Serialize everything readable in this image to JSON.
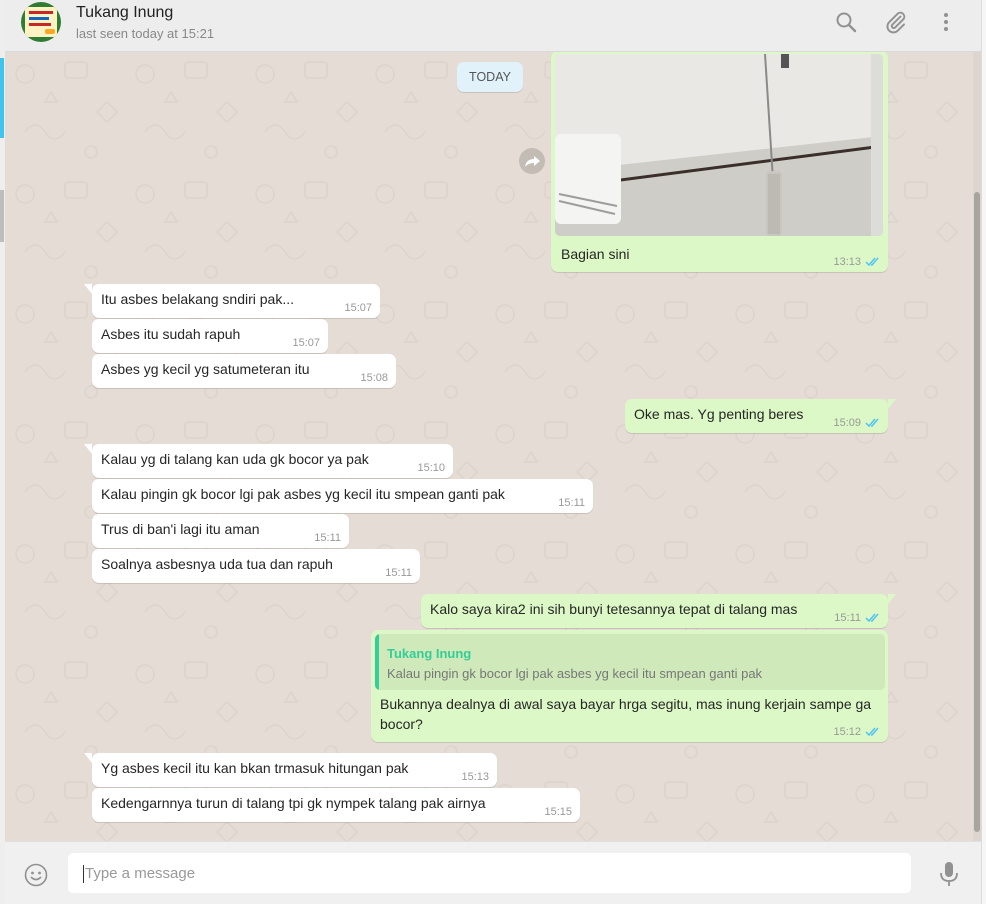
{
  "header": {
    "contact_name": "Tukang Inung",
    "status": "last seen today at 15:21",
    "icons": [
      "search-icon",
      "attach-icon",
      "menu-icon"
    ]
  },
  "date_divider": "TODAY",
  "messages": [
    {
      "id": "m1",
      "dir": "out",
      "type": "image",
      "caption": "Bagian sini",
      "time": "13:13",
      "status": "read"
    },
    {
      "id": "m2",
      "dir": "in",
      "text": "Itu asbes belakang sndiri pak...",
      "time": "15:07"
    },
    {
      "id": "m3",
      "dir": "in",
      "text": "Asbes itu sudah rapuh",
      "time": "15:07"
    },
    {
      "id": "m4",
      "dir": "in",
      "text": "Asbes yg kecil yg satumeteran itu",
      "time": "15:08"
    },
    {
      "id": "m5",
      "dir": "out",
      "text": "Oke mas. Yg penting beres",
      "time": "15:09",
      "status": "read"
    },
    {
      "id": "m6",
      "dir": "in",
      "text": "Kalau yg di talang kan uda gk bocor ya pak",
      "time": "15:10"
    },
    {
      "id": "m7",
      "dir": "in",
      "text": "Kalau pingin gk bocor lgi pak asbes yg kecil itu smpean ganti pak",
      "time": "15:11"
    },
    {
      "id": "m8",
      "dir": "in",
      "text": "Trus di ban'i lagi itu aman",
      "time": "15:11"
    },
    {
      "id": "m9",
      "dir": "in",
      "text": "Soalnya asbesnya uda tua dan rapuh",
      "time": "15:11"
    },
    {
      "id": "m10",
      "dir": "out",
      "text": "Kalo saya kira2 ini sih bunyi tetesannya tepat di talang mas",
      "time": "15:11",
      "status": "read"
    },
    {
      "id": "m11",
      "dir": "out",
      "quote": {
        "name": "Tukang Inung",
        "text": "Kalau pingin gk bocor lgi pak asbes yg kecil itu smpean ganti pak"
      },
      "text_line1": "Bukannya dealnya di awal saya bayar hrga segitu, mas inung kerjain sampe ga",
      "text_line2": "bocor?",
      "time": "15:12",
      "status": "read"
    },
    {
      "id": "m12",
      "dir": "in",
      "text": "Yg asbes kecil itu kan bkan trmasuk hitungan pak",
      "time": "15:13"
    },
    {
      "id": "m13",
      "dir": "in",
      "text": "Kedengarnnya turun di talang tpi gk nympek talang pak airnya",
      "time": "15:15"
    }
  ],
  "composer": {
    "placeholder": "Type a message",
    "icons": [
      "emoji-icon",
      "mic-icon"
    ]
  },
  "colors": {
    "chat_bg": "#e5ddd5",
    "outgoing": "#dcf8c6",
    "incoming": "#ffffff",
    "read_tick": "#4fc3f7",
    "quote_accent": "#35cd96"
  }
}
